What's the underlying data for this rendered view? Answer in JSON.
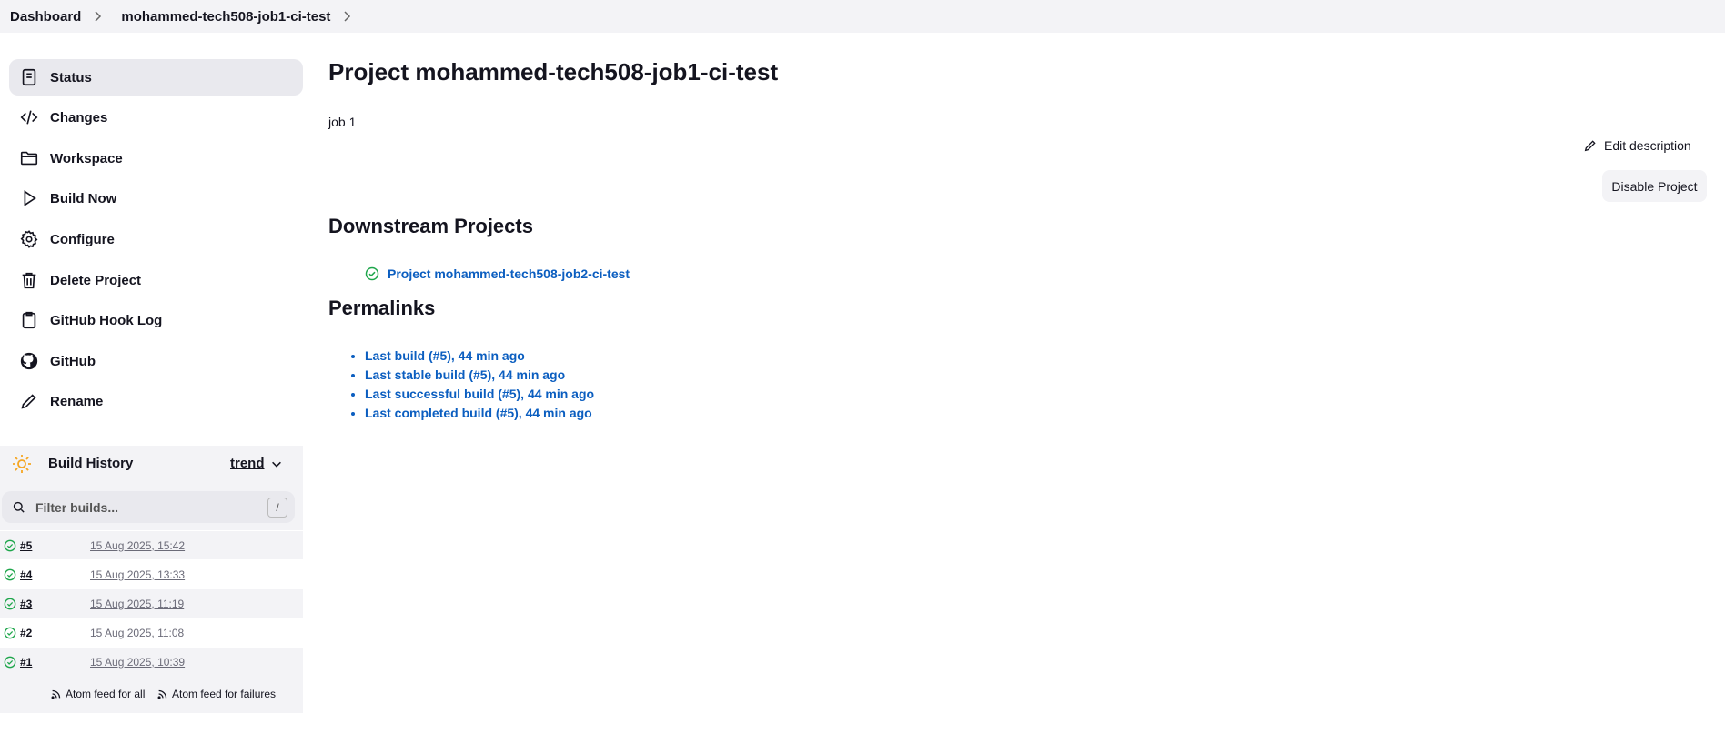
{
  "breadcrumb": {
    "items": [
      "Dashboard",
      "mohammed-tech508-job1-ci-test"
    ]
  },
  "sidebar": {
    "items": [
      {
        "label": "Status",
        "icon": "document-icon"
      },
      {
        "label": "Changes",
        "icon": "code-icon"
      },
      {
        "label": "Workspace",
        "icon": "folder-icon"
      },
      {
        "label": "Build Now",
        "icon": "play-icon"
      },
      {
        "label": "Configure",
        "icon": "gear-icon"
      },
      {
        "label": "Delete Project",
        "icon": "trash-icon"
      },
      {
        "label": "GitHub Hook Log",
        "icon": "clipboard-icon"
      },
      {
        "label": "GitHub",
        "icon": "github-icon"
      },
      {
        "label": "Rename",
        "icon": "pencil-icon"
      }
    ]
  },
  "build_history": {
    "title": "Build History",
    "trend_label": "trend",
    "filter_placeholder": "Filter builds...",
    "filter_shortcut": "/",
    "builds": [
      {
        "number": "#5",
        "date": "15 Aug 2025, 15:42"
      },
      {
        "number": "#4",
        "date": "15 Aug 2025, 13:33"
      },
      {
        "number": "#3",
        "date": "15 Aug 2025, 11:19"
      },
      {
        "number": "#2",
        "date": "15 Aug 2025, 11:08"
      },
      {
        "number": "#1",
        "date": "15 Aug 2025, 10:39"
      }
    ],
    "feed_all": "Atom feed for all",
    "feed_failures": "Atom feed for failures"
  },
  "main": {
    "title": "Project mohammed-tech508-job1-ci-test",
    "description": "job 1",
    "edit_description": "Edit description",
    "disable_button": "Disable Project",
    "downstream_heading": "Downstream Projects",
    "downstream_project": "Project mohammed-tech508-job2-ci-test",
    "permalinks_heading": "Permalinks",
    "permalinks": [
      "Last build (#5), 44 min ago",
      "Last stable build (#5), 44 min ago",
      "Last successful build (#5), 44 min ago",
      "Last completed build (#5), 44 min ago"
    ]
  },
  "colors": {
    "link": "#0b5ec0",
    "success": "#1ea64b",
    "sun": "#f5a623",
    "panel": "#f3f3f6",
    "active": "#e9e9ee"
  }
}
